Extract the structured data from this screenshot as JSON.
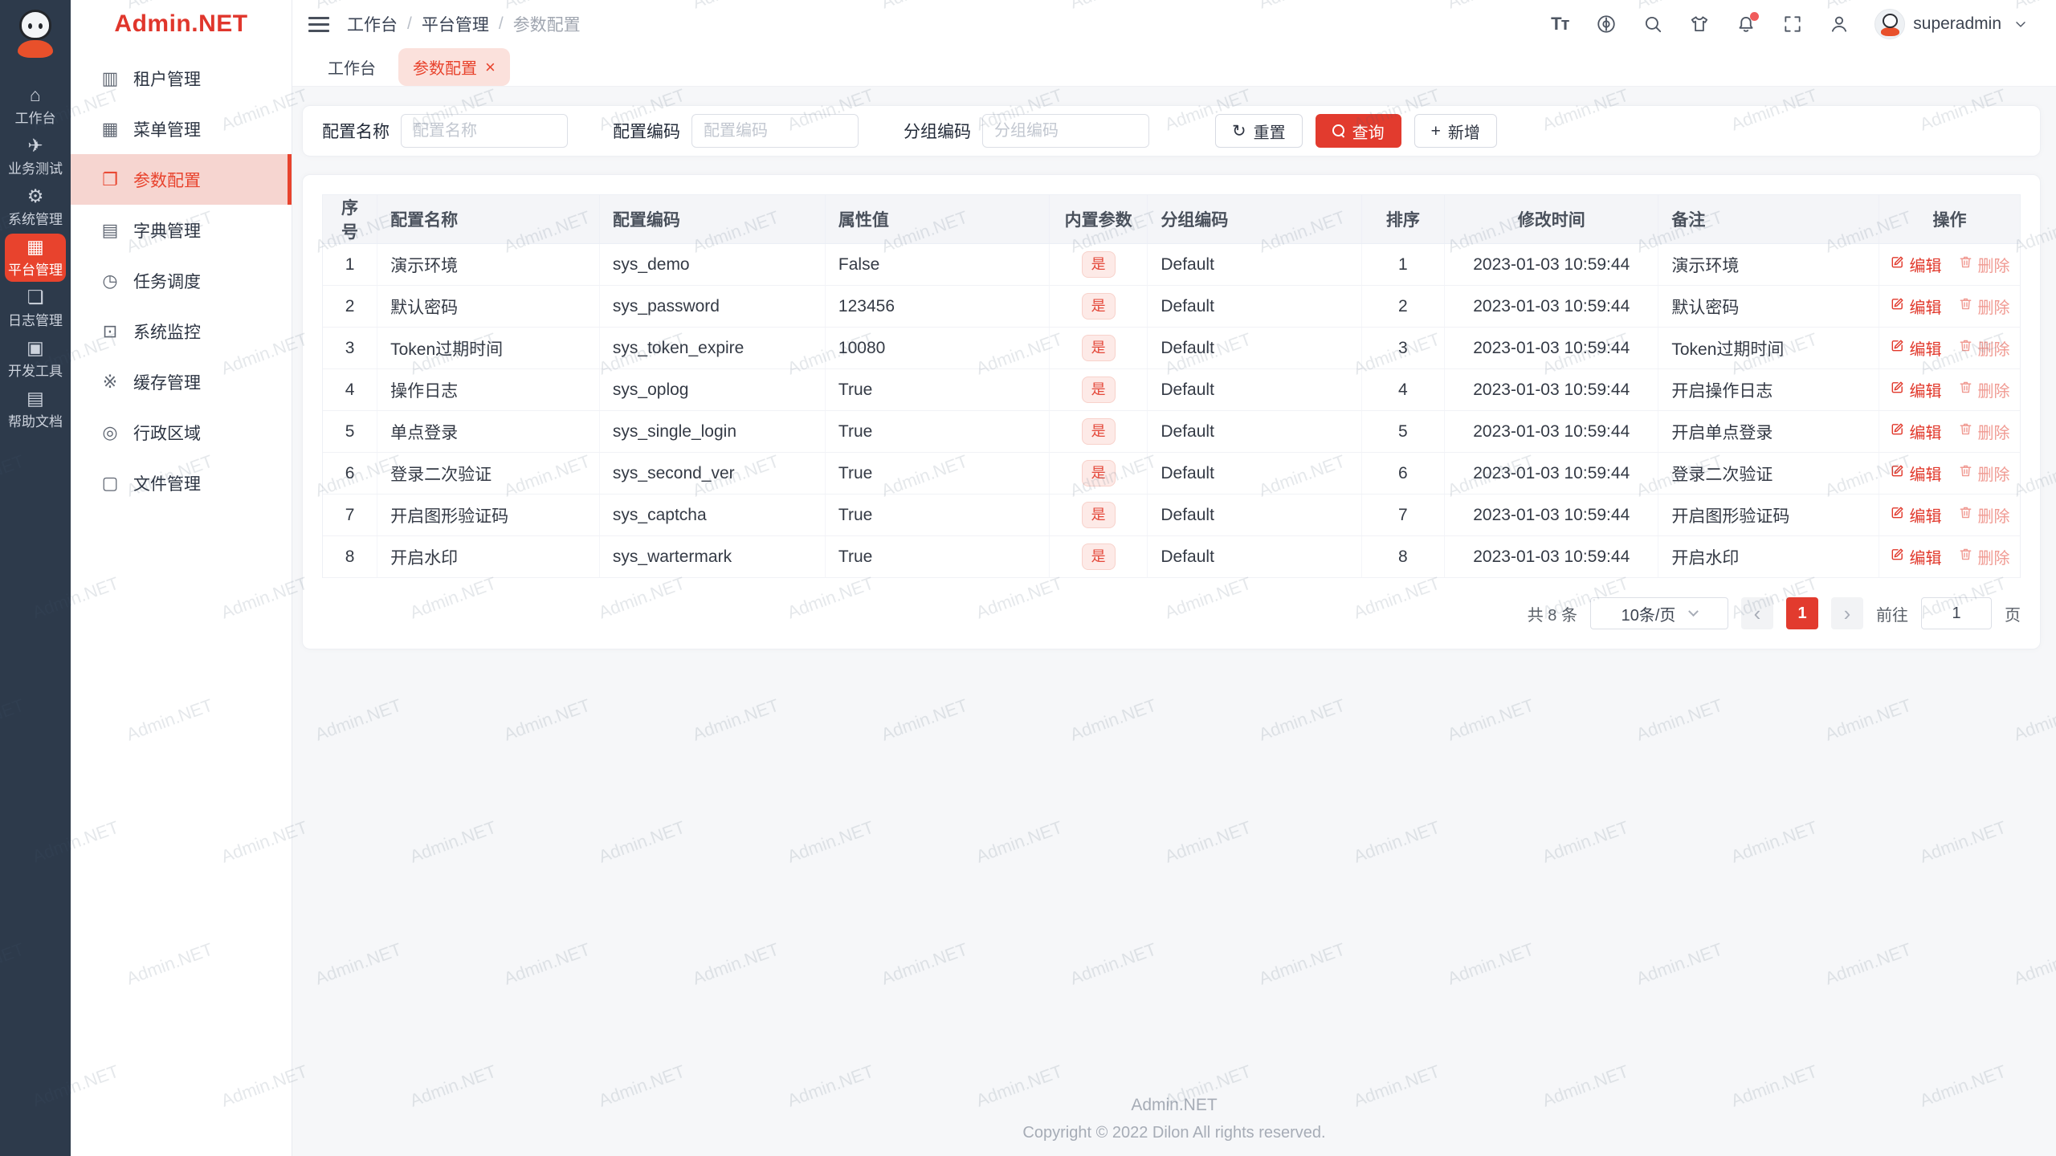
{
  "brand": {
    "logo_text": "Admin.NET"
  },
  "watermark": {
    "text": "Admin.NET"
  },
  "rail": {
    "items": [
      {
        "name": "workbench",
        "glyph": "⌂",
        "label": "工作台",
        "active": false
      },
      {
        "name": "business-test",
        "glyph": "✈",
        "label": "业务测试",
        "active": false
      },
      {
        "name": "system-management",
        "glyph": "⚙",
        "label": "系统管理",
        "active": false
      },
      {
        "name": "platform-management",
        "glyph": "▦",
        "label": "平台管理",
        "active": true
      },
      {
        "name": "log-management",
        "glyph": "❏",
        "label": "日志管理",
        "active": false
      },
      {
        "name": "dev-tools",
        "glyph": "▣",
        "label": "开发工具",
        "active": false
      },
      {
        "name": "help-docs",
        "glyph": "▤",
        "label": "帮助文档",
        "active": false
      }
    ]
  },
  "sidebar": {
    "items": [
      {
        "name": "tenant-management",
        "glyph": "▥",
        "label": "租户管理",
        "active": false
      },
      {
        "name": "menu-management",
        "glyph": "▦",
        "label": "菜单管理",
        "active": false
      },
      {
        "name": "param-config",
        "glyph": "❐",
        "label": "参数配置",
        "active": true
      },
      {
        "name": "dict-management",
        "glyph": "▤",
        "label": "字典管理",
        "active": false
      },
      {
        "name": "task-scheduling",
        "glyph": "◷",
        "label": "任务调度",
        "active": false
      },
      {
        "name": "system-monitor",
        "glyph": "⊡",
        "label": "系统监控",
        "active": false
      },
      {
        "name": "cache-management",
        "glyph": "※",
        "label": "缓存管理",
        "active": false
      },
      {
        "name": "admin-region",
        "glyph": "◎",
        "label": "行政区域",
        "active": false
      },
      {
        "name": "file-management",
        "glyph": "▢",
        "label": "文件管理",
        "active": false
      }
    ]
  },
  "topbar": {
    "breadcrumb": [
      "工作台",
      "平台管理",
      "参数配置"
    ],
    "breadcrumb_separator": "/",
    "font_icon_glyph": "Tт",
    "username": "superadmin"
  },
  "tabs": [
    {
      "label": "工作台",
      "active": false,
      "closable": false
    },
    {
      "label": "参数配置",
      "active": true,
      "closable": true
    }
  ],
  "icons": {
    "close": "×",
    "refresh": "↻",
    "plus": "+",
    "prev": "‹",
    "next": "›"
  },
  "filters": [
    {
      "label": "配置名称",
      "placeholder": "配置名称",
      "value": ""
    },
    {
      "label": "配置编码",
      "placeholder": "配置编码",
      "value": ""
    },
    {
      "label": "分组编码",
      "placeholder": "分组编码",
      "value": ""
    }
  ],
  "toolbar": {
    "reset_label": "重置",
    "search_label": "查询",
    "add_label": "新增"
  },
  "table": {
    "columns": [
      {
        "key": "index",
        "label": "序号",
        "align": "center"
      },
      {
        "key": "name",
        "label": "配置名称",
        "align": "left"
      },
      {
        "key": "code",
        "label": "配置编码",
        "align": "left"
      },
      {
        "key": "value",
        "label": "属性值",
        "align": "left"
      },
      {
        "key": "builtin",
        "label": "内置参数",
        "align": "center"
      },
      {
        "key": "group",
        "label": "分组编码",
        "align": "left"
      },
      {
        "key": "sort",
        "label": "排序",
        "align": "center"
      },
      {
        "key": "time",
        "label": "修改时间",
        "align": "center"
      },
      {
        "key": "remark",
        "label": "备注",
        "align": "left"
      },
      {
        "key": "ops",
        "label": "操作",
        "align": "center"
      }
    ],
    "edit_label": "编辑",
    "delete_label": "删除",
    "rows": [
      {
        "index": "1",
        "name": "演示环境",
        "code": "sys_demo",
        "value": "False",
        "builtin": "是",
        "group": "Default",
        "sort": "1",
        "time": "2023-01-03 10:59:44",
        "remark": "演示环境"
      },
      {
        "index": "2",
        "name": "默认密码",
        "code": "sys_password",
        "value": "123456",
        "builtin": "是",
        "group": "Default",
        "sort": "2",
        "time": "2023-01-03 10:59:44",
        "remark": "默认密码"
      },
      {
        "index": "3",
        "name": "Token过期时间",
        "code": "sys_token_expire",
        "value": "10080",
        "builtin": "是",
        "group": "Default",
        "sort": "3",
        "time": "2023-01-03 10:59:44",
        "remark": "Token过期时间"
      },
      {
        "index": "4",
        "name": "操作日志",
        "code": "sys_oplog",
        "value": "True",
        "builtin": "是",
        "group": "Default",
        "sort": "4",
        "time": "2023-01-03 10:59:44",
        "remark": "开启操作日志"
      },
      {
        "index": "5",
        "name": "单点登录",
        "code": "sys_single_login",
        "value": "True",
        "builtin": "是",
        "group": "Default",
        "sort": "5",
        "time": "2023-01-03 10:59:44",
        "remark": "开启单点登录"
      },
      {
        "index": "6",
        "name": "登录二次验证",
        "code": "sys_second_ver",
        "value": "True",
        "builtin": "是",
        "group": "Default",
        "sort": "6",
        "time": "2023-01-03 10:59:44",
        "remark": "登录二次验证"
      },
      {
        "index": "7",
        "name": "开启图形验证码",
        "code": "sys_captcha",
        "value": "True",
        "builtin": "是",
        "group": "Default",
        "sort": "7",
        "time": "2023-01-03 10:59:44",
        "remark": "开启图形验证码"
      },
      {
        "index": "8",
        "name": "开启水印",
        "code": "sys_wartermark",
        "value": "True",
        "builtin": "是",
        "group": "Default",
        "sort": "8",
        "time": "2023-01-03 10:59:44",
        "remark": "开启水印"
      }
    ]
  },
  "pagination": {
    "total": "共 8 条",
    "page_size": "10条/页",
    "page": "1",
    "goto_label": "前往",
    "goto_value": "1",
    "unit_label": "页"
  },
  "footer": {
    "title": "Admin.NET",
    "copyright": "Copyright © 2022 Dilon All rights reserved."
  },
  "accent_colors": {
    "primary": "#e23b2e",
    "rail_active": "#e8432d",
    "tag_bg": "#fdeae7",
    "tag_text": "#e4483a",
    "rail_bg": "#2d3a4b"
  }
}
